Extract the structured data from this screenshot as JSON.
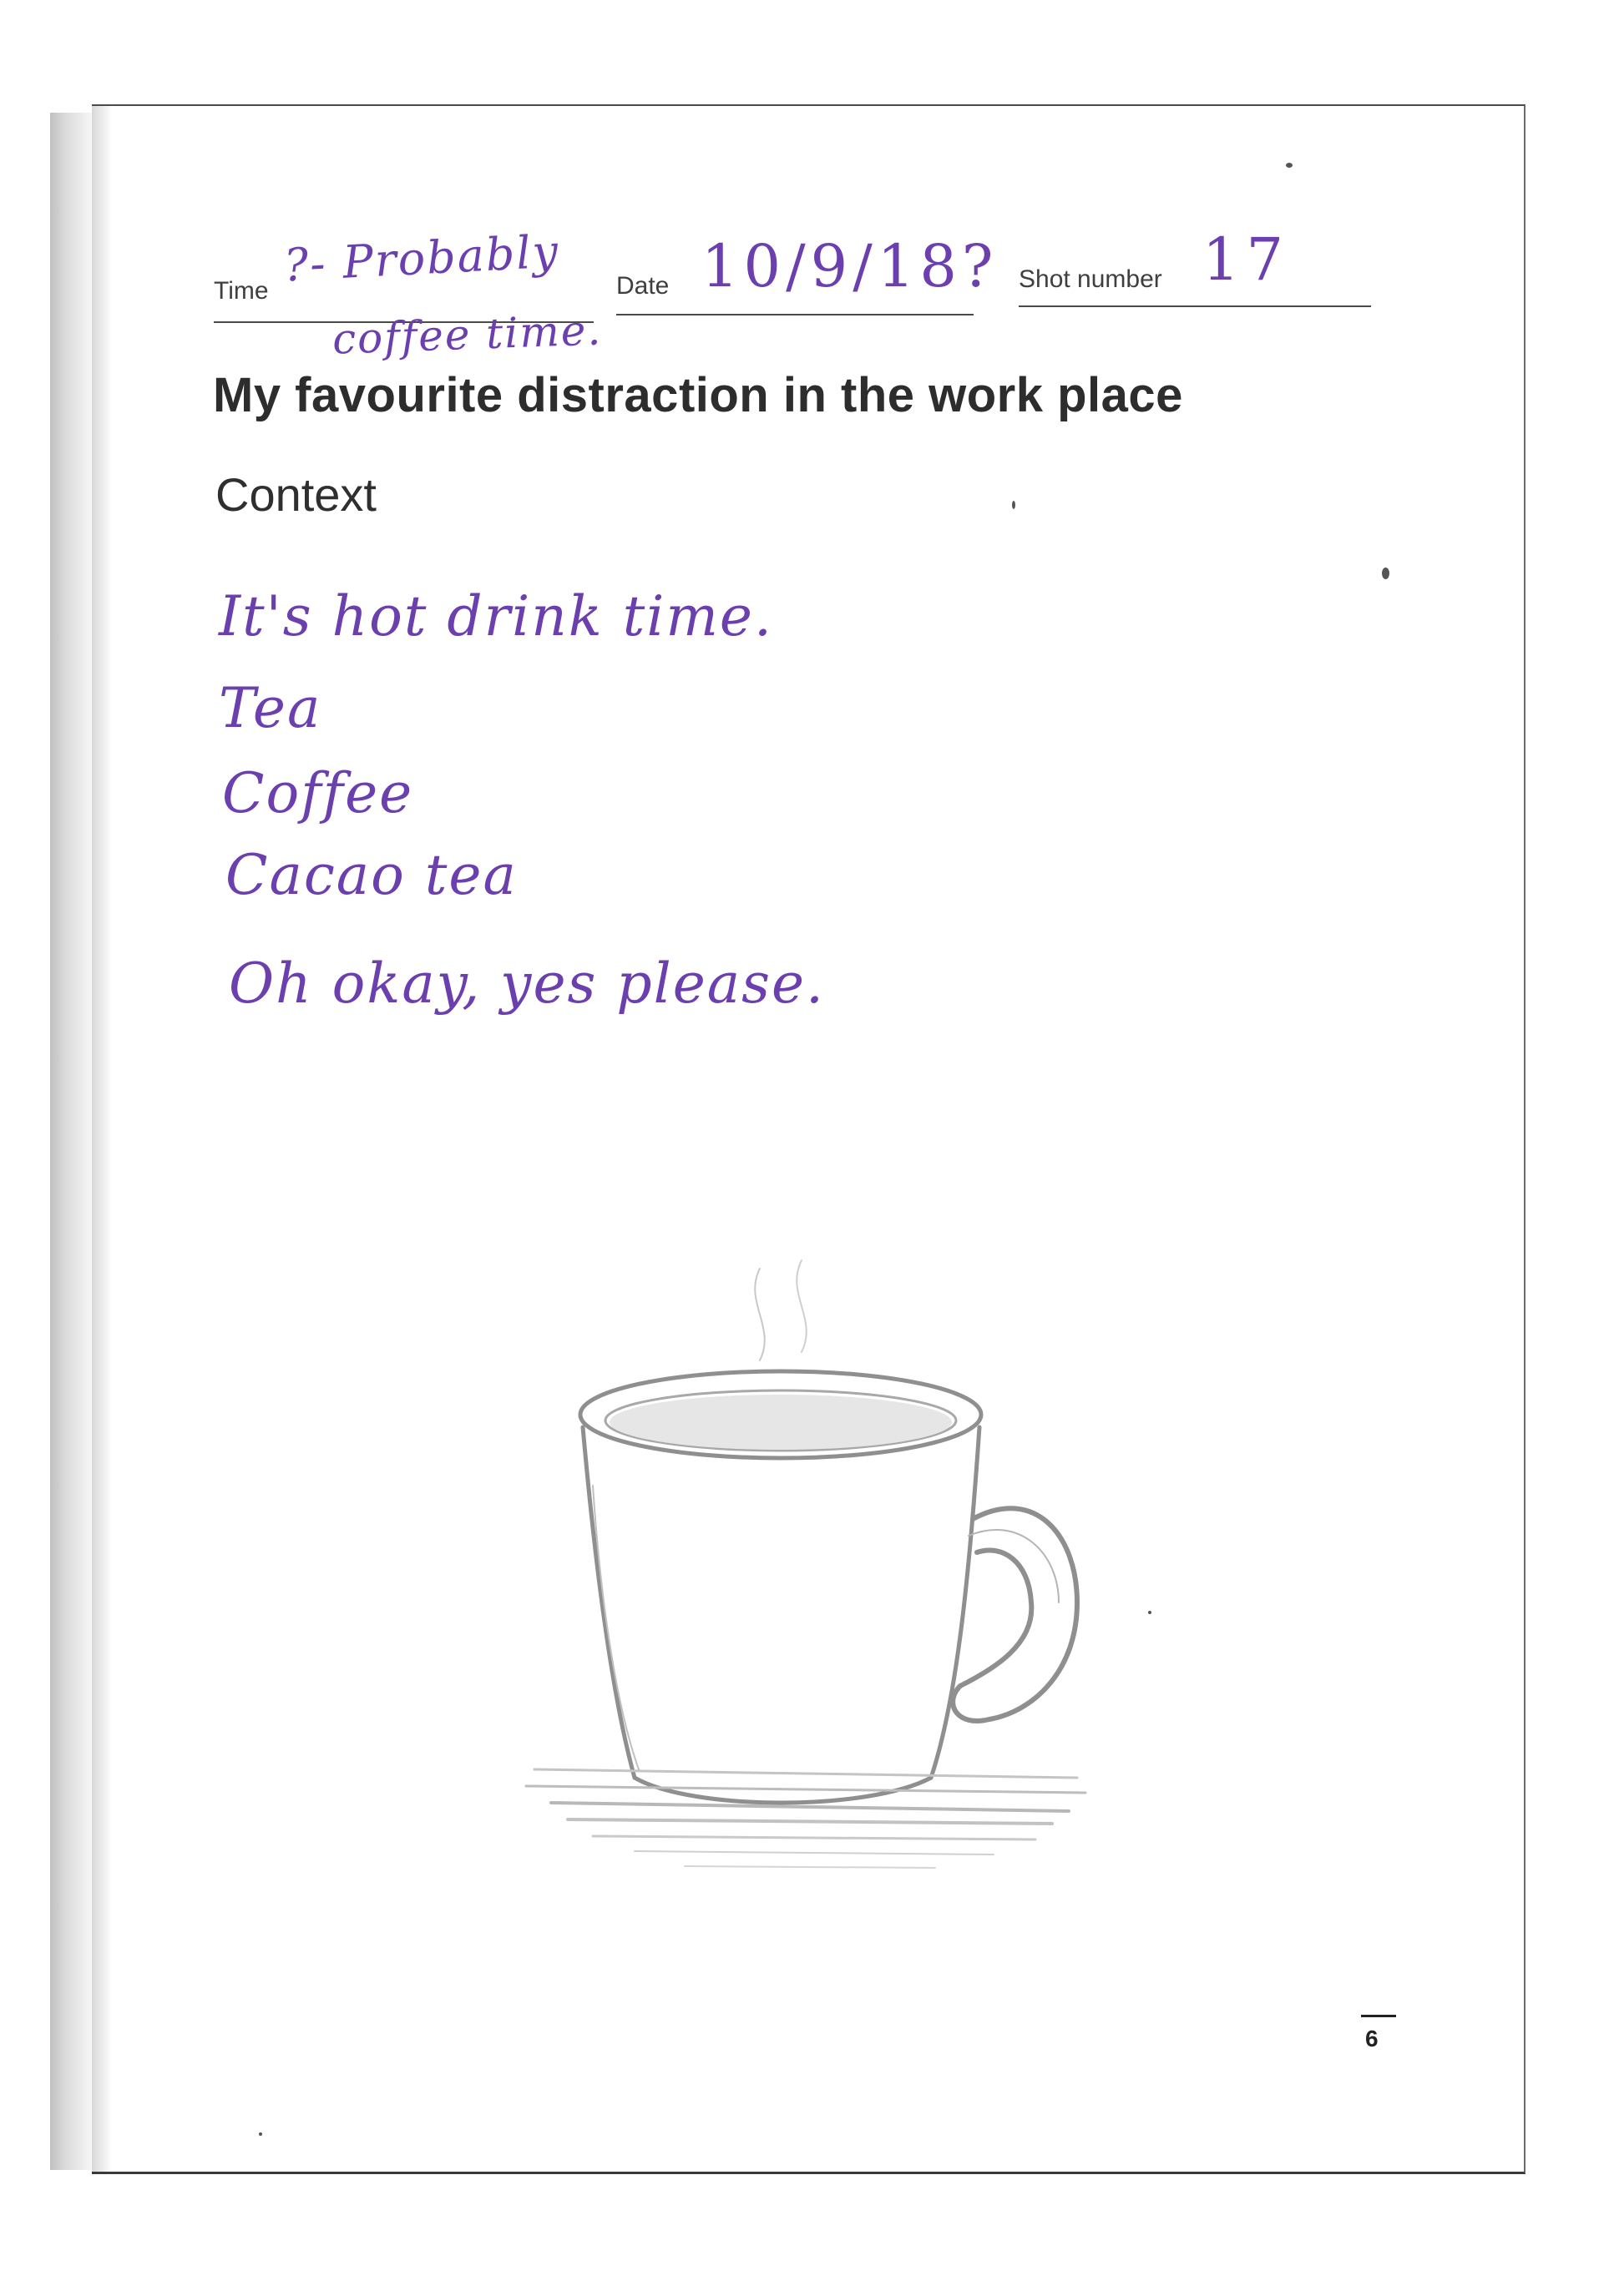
{
  "form": {
    "time_label": "Time",
    "date_label": "Date",
    "shot_label": "Shot number"
  },
  "handwriting": {
    "time_line1": "?- Probably",
    "time_line2": "coffee time.",
    "date_value": "10/9/18?",
    "shot_value": "17",
    "context_lines": [
      "It's hot drink time.",
      "Tea",
      "Coffee",
      "Cacao tea",
      "Oh okay, yes please."
    ]
  },
  "page": {
    "title": "My favourite distraction in the work place",
    "section_heading": "Context",
    "page_number": "6"
  },
  "illustration": {
    "subject": "coffee-mug-icon",
    "style": "pencil sketch"
  },
  "colors": {
    "ink": "#6b3fae",
    "print": "#2d2d2d",
    "pencil": "#8a8a8a"
  }
}
